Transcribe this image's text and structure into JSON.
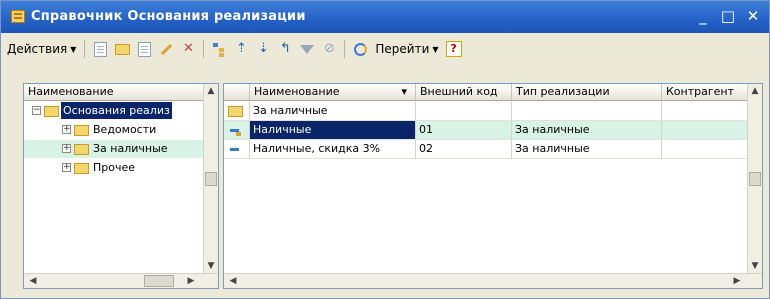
{
  "window": {
    "title": "Справочник Основания реализации",
    "controls": [
      "_",
      "□",
      "✕"
    ]
  },
  "toolbar": {
    "actions_label": "Действия",
    "goto_label": "Перейти",
    "help_label": "?",
    "icons": [
      "add-icon",
      "add-group-icon",
      "copy-icon",
      "edit-icon",
      "delete-icon",
      "hierarchy-icon",
      "move-up-icon",
      "move-down-icon",
      "level-up-icon",
      "filter-icon",
      "filter-off-icon",
      "refresh-icon",
      "help-icon"
    ]
  },
  "tree": {
    "header": "Наименование",
    "items": [
      {
        "label": "Основания реализ",
        "expander": "−",
        "level": 0,
        "selected": true
      },
      {
        "label": "Ведомости",
        "expander": "+",
        "level": 1
      },
      {
        "label": "За наличные",
        "expander": "+",
        "level": 1,
        "highlighted": true
      },
      {
        "label": "Прочее",
        "expander": "+",
        "level": 1
      }
    ]
  },
  "grid": {
    "columns": [
      "Наименование",
      "Внешний код",
      "Тип реализации",
      "Контрагент"
    ],
    "sort_indicator": "▾",
    "rows": [
      {
        "icon": "folder-icon",
        "name": "За наличные",
        "code": "",
        "type": "",
        "contractor": ""
      },
      {
        "icon": "item-edit-icon",
        "name": "Наличные",
        "code": "01",
        "type": "За наличные",
        "contractor": "",
        "selected": true
      },
      {
        "icon": "item-icon",
        "name": "Наличные, скидка 3%",
        "code": "02",
        "type": "За наличные",
        "contractor": ""
      }
    ]
  },
  "colors": {
    "titlebar": "#2461c6",
    "selection": "#0a246a",
    "highlight_row": "#d9f2e6",
    "window_bg": "#ece9d8"
  }
}
